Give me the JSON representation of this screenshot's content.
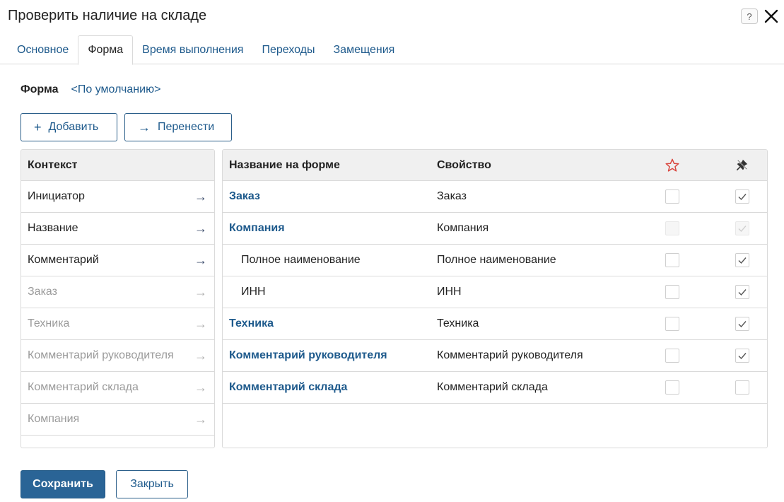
{
  "dialog": {
    "title": "Проверить наличие на складе",
    "help_icon": "question-icon",
    "close_icon": "close-icon"
  },
  "tabs": [
    {
      "label": "Основное",
      "active": false
    },
    {
      "label": "Форма",
      "active": true
    },
    {
      "label": "Время выполнения",
      "active": false
    },
    {
      "label": "Переходы",
      "active": false
    },
    {
      "label": "Замещения",
      "active": false
    }
  ],
  "form": {
    "label": "Форма",
    "value": "<По умолчанию>"
  },
  "toolbar": {
    "add_label": "Добавить",
    "move_label": "Перенести"
  },
  "context": {
    "header": "Контекст",
    "items": [
      {
        "label": "Инициатор",
        "enabled": true
      },
      {
        "label": "Название",
        "enabled": true
      },
      {
        "label": "Комментарий",
        "enabled": true
      },
      {
        "label": "Заказ",
        "enabled": false
      },
      {
        "label": "Техника",
        "enabled": false
      },
      {
        "label": "Комментарий руководителя",
        "enabled": false
      },
      {
        "label": "Комментарий склада",
        "enabled": false
      },
      {
        "label": "Компания",
        "enabled": false
      }
    ]
  },
  "table": {
    "headers": {
      "name": "Название на форме",
      "property": "Свойство",
      "required_icon": "star-icon",
      "readonly_icon": "pin-icon"
    },
    "rows": [
      {
        "name": "Заказ",
        "property": "Заказ",
        "link": true,
        "sub": false,
        "required": false,
        "readonly": true,
        "disabled": false
      },
      {
        "name": "Компания",
        "property": "Компания",
        "link": true,
        "sub": false,
        "required": false,
        "readonly": true,
        "disabled": true
      },
      {
        "name": "Полное наименование",
        "property": "Полное наименование",
        "link": false,
        "sub": true,
        "required": false,
        "readonly": true,
        "disabled": false
      },
      {
        "name": "ИНН",
        "property": "ИНН",
        "link": false,
        "sub": true,
        "required": false,
        "readonly": true,
        "disabled": false
      },
      {
        "name": "Техника",
        "property": "Техника",
        "link": true,
        "sub": false,
        "required": false,
        "readonly": true,
        "disabled": false
      },
      {
        "name": "Комментарий руководителя",
        "property": "Комментарий руководителя",
        "link": true,
        "sub": false,
        "required": false,
        "readonly": true,
        "disabled": false
      },
      {
        "name": "Комментарий склада",
        "property": "Комментарий склада",
        "link": true,
        "sub": false,
        "required": false,
        "readonly": false,
        "disabled": false
      }
    ]
  },
  "footer": {
    "save_label": "Сохранить",
    "close_label": "Закрыть"
  },
  "colors": {
    "accent": "#2a6496",
    "link": "#1e5a8c",
    "star": "#d9453d",
    "border": "#dadada",
    "header_bg": "#f0f0f0"
  }
}
